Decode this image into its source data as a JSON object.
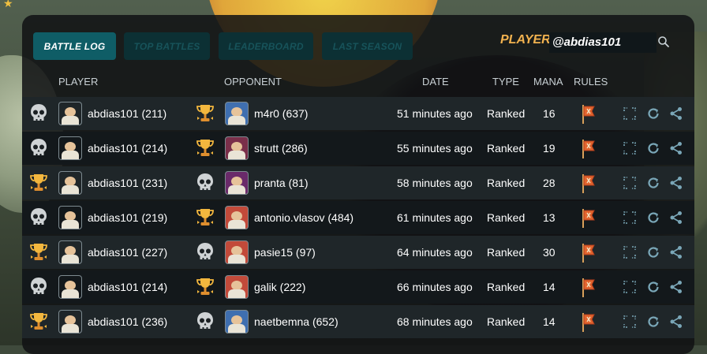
{
  "colors": {
    "accent": "#0f5d66",
    "player_label": "#f2b24f",
    "action": "#7aa7b8"
  },
  "tabs": [
    {
      "label": "BATTLE LOG",
      "active": true
    },
    {
      "label": "TOP BATTLES",
      "active": false
    },
    {
      "label": "LEADERBOARD",
      "active": false
    },
    {
      "label": "LAST SEASON",
      "active": false
    }
  ],
  "player": {
    "label": "PLAYER:",
    "value": "@abdias101"
  },
  "headers": {
    "player": "PLAYER",
    "opponent": "OPPONENT",
    "date": "DATE",
    "type": "TYPE",
    "mana": "MANA",
    "rules": "RULES"
  },
  "rows": [
    {
      "player_result": "skull-icon",
      "player": "abdias101 (211)",
      "player_avatar": "#5f7aa8",
      "opp_result": "trophy-icon",
      "opponent": "m4r0 (637)",
      "opp_avatar": "#3f6fb0",
      "date": "51 minutes ago",
      "type": "Ranked",
      "mana": "16"
    },
    {
      "player_result": "skull-icon",
      "player": "abdias101 (214)",
      "player_avatar": "#3f6fb0",
      "opp_result": "trophy-icon",
      "opponent": "strutt (286)",
      "opp_avatar": "#7a2f4a",
      "date": "55 minutes ago",
      "type": "Ranked",
      "mana": "19"
    },
    {
      "player_result": "trophy-icon",
      "player": "abdias101 (231)",
      "player_avatar": "#3f6fb0",
      "opp_result": "skull-icon",
      "opponent": "pranta (81)",
      "opp_avatar": "#6a2a6a",
      "date": "58 minutes ago",
      "type": "Ranked",
      "mana": "28"
    },
    {
      "player_result": "skull-icon",
      "player": "abdias101 (219)",
      "player_avatar": "#7a2f4a",
      "opp_result": "trophy-icon",
      "opponent": "antonio.vlasov (484)",
      "opp_avatar": "#c24a3a",
      "date": "61 minutes ago",
      "type": "Ranked",
      "mana": "13"
    },
    {
      "player_result": "trophy-icon",
      "player": "abdias101 (227)",
      "player_avatar": "#7a2f4a",
      "opp_result": "skull-icon",
      "opponent": "pasie15 (97)",
      "opp_avatar": "#c24a3a",
      "date": "64 minutes ago",
      "type": "Ranked",
      "mana": "30"
    },
    {
      "player_result": "skull-icon",
      "player": "abdias101 (214)",
      "player_avatar": "#5a9a4a",
      "opp_result": "trophy-icon",
      "opponent": "galik (222)",
      "opp_avatar": "#c24a3a",
      "date": "66 minutes ago",
      "type": "Ranked",
      "mana": "14"
    },
    {
      "player_result": "trophy-icon",
      "player": "abdias101 (236)",
      "player_avatar": "#5a9a4a",
      "opp_result": "skull-icon",
      "opponent": "naetbemna (652)",
      "opp_avatar": "#3f6fb0",
      "date": "68 minutes ago",
      "type": "Ranked",
      "mana": "14"
    }
  ]
}
